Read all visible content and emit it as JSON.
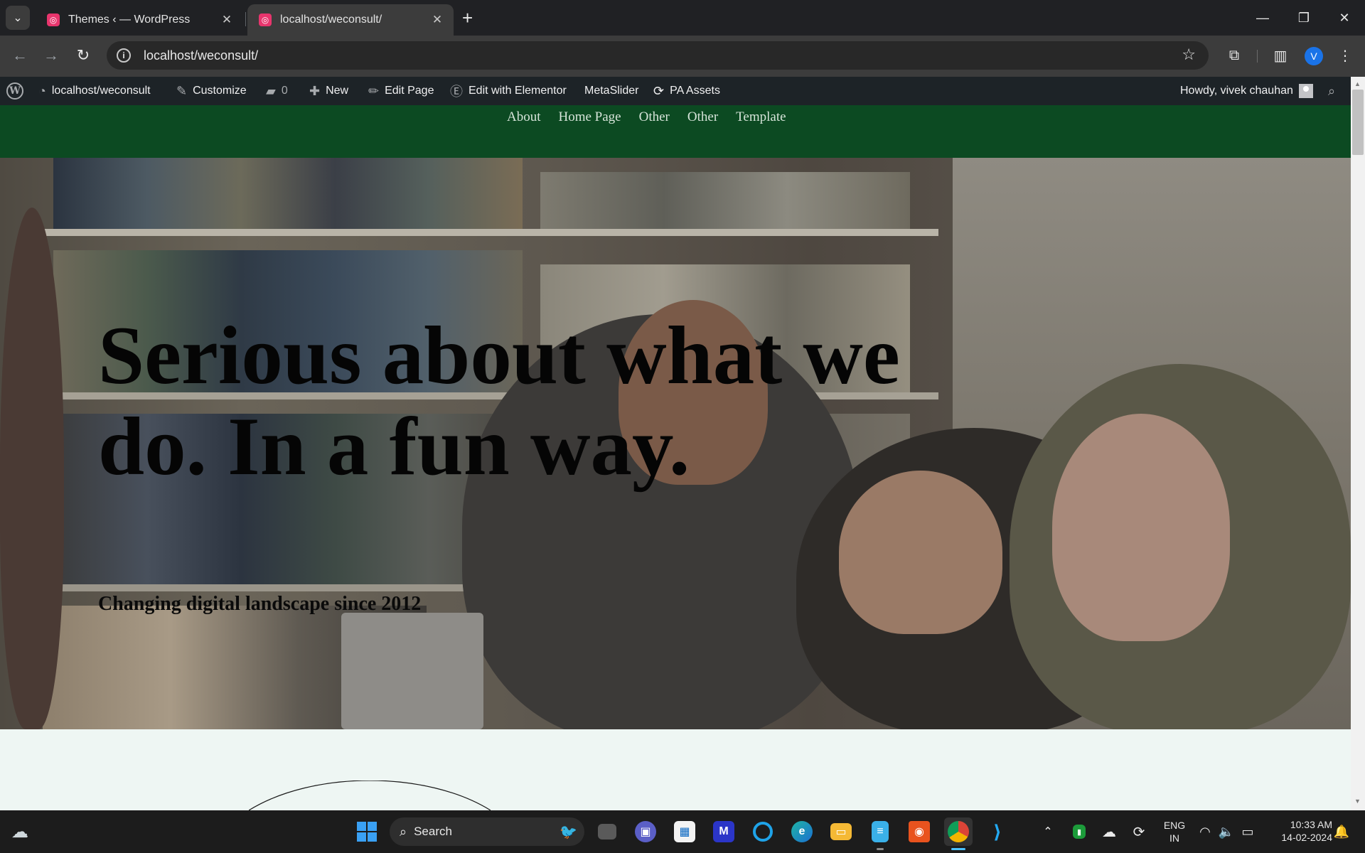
{
  "browser": {
    "tabs": [
      {
        "title": "Themes ‹ — WordPress",
        "close": "✕"
      },
      {
        "title": "localhost/weconsult/",
        "close": "✕"
      }
    ],
    "new_tab": "+",
    "url": "localhost/weconsult/",
    "window_controls": {
      "minimize": "—",
      "restore": "❐",
      "close": "✕"
    },
    "profile_initial": "V"
  },
  "admin_bar": {
    "site": "localhost/weconsult",
    "customize": "Customize",
    "comments": "0",
    "new": "New",
    "edit_page": "Edit Page",
    "edit_elementor": "Edit with Elementor",
    "metaslider": "MetaSlider",
    "pa_assets": "PA Assets",
    "howdy": "Howdy, vivek chauhan"
  },
  "site_nav": {
    "items": [
      "About",
      "Home Page",
      "Other",
      "Other",
      "Template"
    ],
    "background": "#0c4a22"
  },
  "hero": {
    "title": "Serious about what we do. In a fun way.",
    "subtitle": "Changing digital landscape since 2012"
  },
  "taskbar": {
    "search_label": "Search",
    "lang_1": "ENG",
    "lang_2": "IN",
    "time": "10:33 AM",
    "date": "14-02-2024"
  }
}
